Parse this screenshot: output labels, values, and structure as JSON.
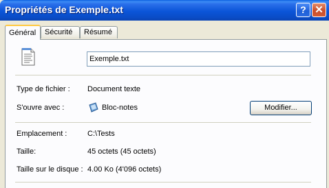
{
  "window": {
    "title": "Propriétés de Exemple.txt",
    "help_label": "?",
    "close_label": "✕"
  },
  "tabs": [
    {
      "label": "Général",
      "active": true
    },
    {
      "label": "Sécurité",
      "active": false
    },
    {
      "label": "Résumé",
      "active": false
    }
  ],
  "general": {
    "file_name_value": "Exemple.txt",
    "file_type_label": "Type de fichier :",
    "file_type_value": "Document texte",
    "opens_with_label": "S'ouvre avec :",
    "opens_with_value": "Bloc-notes",
    "modify_button_label": "Modifier...",
    "location_label": "Emplacement :",
    "location_value": "C:\\Tests",
    "size_label": "Taille:",
    "size_value": "45 octets (45 octets)",
    "size_on_disk_label": "Taille sur le disque :",
    "size_on_disk_value": "4.00 Ko (4'096 octets)"
  },
  "icons": {
    "file": "text-document-icon",
    "opens_with": "notepad-icon"
  }
}
